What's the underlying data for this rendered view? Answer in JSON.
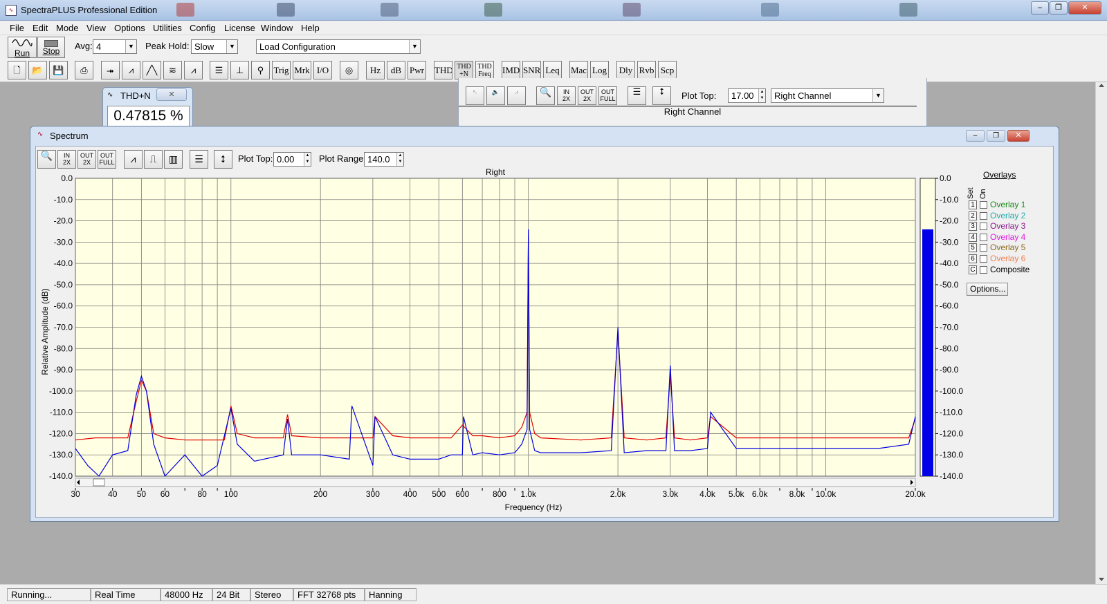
{
  "app": {
    "title": "SpectraPLUS Professional Edition",
    "window_buttons": [
      "‒",
      "❐",
      "✕"
    ]
  },
  "menu": [
    "File",
    "Edit",
    "Mode",
    "View",
    "Options",
    "Utilities",
    "Config",
    "License",
    "Window",
    "Help"
  ],
  "toolbar1": {
    "run_label": "Run",
    "stop_label": "Stop",
    "avg_label": "Avg:",
    "avg_value": "4",
    "peak_hold_label": "Peak Hold:",
    "peak_hold_value": "Slow",
    "config_value": "Load Configuration"
  },
  "toolbar2": {
    "text_buttons": [
      "Trig",
      "Mrk",
      "I/O",
      "Hz",
      "dB",
      "Pwr",
      "THD",
      "THD +N",
      "THD Freq",
      "IMD",
      "SNR",
      "Leq",
      "Mac",
      "Log",
      "Dly",
      "Rvb",
      "Scp"
    ]
  },
  "thd_window": {
    "title": "THD+N",
    "value": "0.47815 %"
  },
  "time_series": {
    "plot_top_label": "Plot Top:",
    "plot_top_value": "17.00",
    "channel_value": "Right Channel",
    "channel_title": "Right Channel"
  },
  "spectrum": {
    "title": "Spectrum",
    "plot_top_label": "Plot Top:",
    "plot_top_value": "0.00",
    "plot_range_label": "Plot Range:",
    "plot_range_value": "140.0",
    "options_label": "Options...",
    "overlays_title": "Overlays",
    "set_label": "Set",
    "on_label": "On",
    "overlays": [
      {
        "set": "1",
        "label": "Overlay 1",
        "color": "#1a8a1a"
      },
      {
        "set": "2",
        "label": "Overlay 2",
        "color": "#22aaaa"
      },
      {
        "set": "3",
        "label": "Overlay 3",
        "color": "#8a1a8a"
      },
      {
        "set": "4",
        "label": "Overlay 4",
        "color": "#e01ae0"
      },
      {
        "set": "5",
        "label": "Overlay 5",
        "color": "#8a6a1a"
      },
      {
        "set": "6",
        "label": "Overlay 6",
        "color": "#f08050"
      },
      {
        "set": "C",
        "label": "Composite",
        "color": "#000000"
      }
    ]
  },
  "chart_data": {
    "type": "line",
    "title": "Right",
    "xlabel": "Frequency (Hz)",
    "ylabel": "Relative Amplitude (dB)",
    "x_scale": "log",
    "xlim": [
      30,
      20000
    ],
    "ylim": [
      -140,
      0
    ],
    "grid": true,
    "x_tick_labels": [
      {
        "v": 30,
        "t": "30"
      },
      {
        "v": 40,
        "t": "40"
      },
      {
        "v": 50,
        "t": "50"
      },
      {
        "v": 60,
        "t": "60"
      },
      {
        "v": 80,
        "t": "80"
      },
      {
        "v": 100,
        "t": "100"
      },
      {
        "v": 200,
        "t": "200"
      },
      {
        "v": 300,
        "t": "300"
      },
      {
        "v": 400,
        "t": "400"
      },
      {
        "v": 500,
        "t": "500"
      },
      {
        "v": 600,
        "t": "600"
      },
      {
        "v": 800,
        "t": "800"
      },
      {
        "v": 1000,
        "t": "1.0k"
      },
      {
        "v": 2000,
        "t": "2.0k"
      },
      {
        "v": 3000,
        "t": "3.0k"
      },
      {
        "v": 4000,
        "t": "4.0k"
      },
      {
        "v": 5000,
        "t": "5.0k"
      },
      {
        "v": 6000,
        "t": "6.0k"
      },
      {
        "v": 8000,
        "t": "8.0k"
      },
      {
        "v": 10000,
        "t": "10.0k"
      },
      {
        "v": 20000,
        "t": "20.0k"
      }
    ],
    "y_tick_labels": [
      "0.0",
      "-10.0",
      "-20.0",
      "-30.0",
      "-40.0",
      "-50.0",
      "-60.0",
      "-70.0",
      "-80.0",
      "-90.0",
      "-100.0",
      "-110.0",
      "-120.0",
      "-130.0",
      "-140.0"
    ],
    "series": [
      {
        "color": "#e00000",
        "x": [
          30,
          35,
          40,
          45,
          48,
          50,
          52,
          55,
          60,
          70,
          80,
          95,
          100,
          105,
          120,
          150,
          155,
          160,
          200,
          250,
          300,
          305,
          350,
          400,
          450,
          550,
          600,
          650,
          700,
          800,
          900,
          950,
          990,
          1000,
          1010,
          1050,
          1100,
          1500,
          1900,
          2000,
          2100,
          2500,
          2900,
          3000,
          3100,
          3500,
          4000,
          4100,
          5000,
          7000,
          10000,
          15000,
          19000,
          20000
        ],
        "values": [
          -123,
          -122,
          -122,
          -122,
          -105,
          -95,
          -100,
          -120,
          -122,
          -123,
          -123,
          -123,
          -107,
          -120,
          -122,
          -122,
          -111,
          -121,
          -122,
          -122,
          -122,
          -112,
          -121,
          -122,
          -122,
          -122,
          -116,
          -121,
          -121,
          -122,
          -121,
          -117,
          -110,
          -27,
          -110,
          -120,
          -122,
          -123,
          -122,
          -72,
          -122,
          -123,
          -122,
          -92,
          -122,
          -123,
          -122,
          -112,
          -122,
          -122,
          -122,
          -122,
          -122,
          -113
        ]
      },
      {
        "color": "#0000e0",
        "x": [
          30,
          33,
          36,
          40,
          45,
          48,
          50,
          52,
          55,
          60,
          70,
          80,
          90,
          100,
          105,
          120,
          150,
          155,
          160,
          200,
          250,
          255,
          300,
          305,
          350,
          400,
          500,
          550,
          600,
          605,
          650,
          700,
          800,
          900,
          950,
          990,
          1000,
          1010,
          1050,
          1100,
          1500,
          1900,
          2000,
          2100,
          2500,
          2900,
          3000,
          3100,
          3500,
          4000,
          4100,
          5000,
          7000,
          10000,
          15000,
          19000,
          20000
        ],
        "values": [
          -127,
          -135,
          -140,
          -130,
          -128,
          -102,
          -93,
          -100,
          -125,
          -140,
          -130,
          -140,
          -135,
          -108,
          -125,
          -133,
          -130,
          -113,
          -130,
          -130,
          -132,
          -107,
          -135,
          -112,
          -130,
          -132,
          -132,
          -130,
          -130,
          -112,
          -130,
          -129,
          -130,
          -129,
          -125,
          -118,
          -24,
          -118,
          -128,
          -129,
          -129,
          -128,
          -70,
          -129,
          -128,
          -128,
          -88,
          -128,
          -128,
          -127,
          -110,
          -127,
          -127,
          -127,
          -127,
          -125,
          -112
        ]
      }
    ],
    "level_meter": {
      "value": -24,
      "tick_labels": [
        "0.0",
        "-10.0",
        "-20.0",
        "-30.0",
        "-40.0",
        "-50.0",
        "-60.0",
        "-70.0",
        "-80.0",
        "-90.0",
        "-100.0",
        "-110.0",
        "-120.0",
        "-130.0",
        "-140.0"
      ]
    }
  },
  "status": {
    "state": "Running...",
    "mode": "Real Time",
    "rate": "48000 Hz",
    "bits": "24 Bit",
    "channels": "Stereo",
    "fft": "FFT 32768 pts",
    "window": "Hanning"
  }
}
